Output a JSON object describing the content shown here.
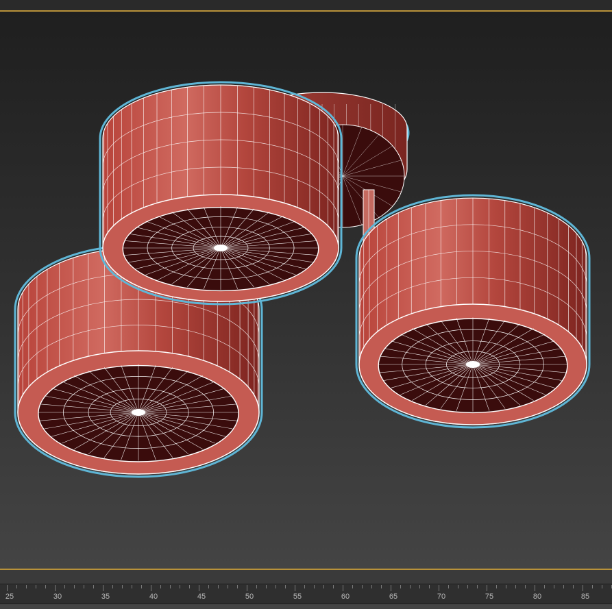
{
  "app": {
    "colors": {
      "viewport_border": "#b9923a",
      "mesh_shade": "#c0504a",
      "mesh_interior": "#3a0c0c",
      "wire": "#ffffff",
      "selection_outline": "#5fb6d6",
      "background_top": "#1f1f1f",
      "background_bottom": "#444444"
    }
  },
  "viewport": {
    "objects": [
      {
        "name": "lamp-shade-top",
        "icon": "cylinder-shade"
      },
      {
        "name": "lamp-shade-right",
        "icon": "cylinder-shade"
      },
      {
        "name": "lamp-shade-left",
        "icon": "cylinder-shade"
      },
      {
        "name": "mount-plate",
        "icon": "disc-plate"
      }
    ]
  },
  "timeline": {
    "frame_labels": [
      "25",
      "30",
      "35",
      "40",
      "45",
      "50",
      "55",
      "60",
      "65",
      "70",
      "75",
      "80",
      "85"
    ]
  }
}
